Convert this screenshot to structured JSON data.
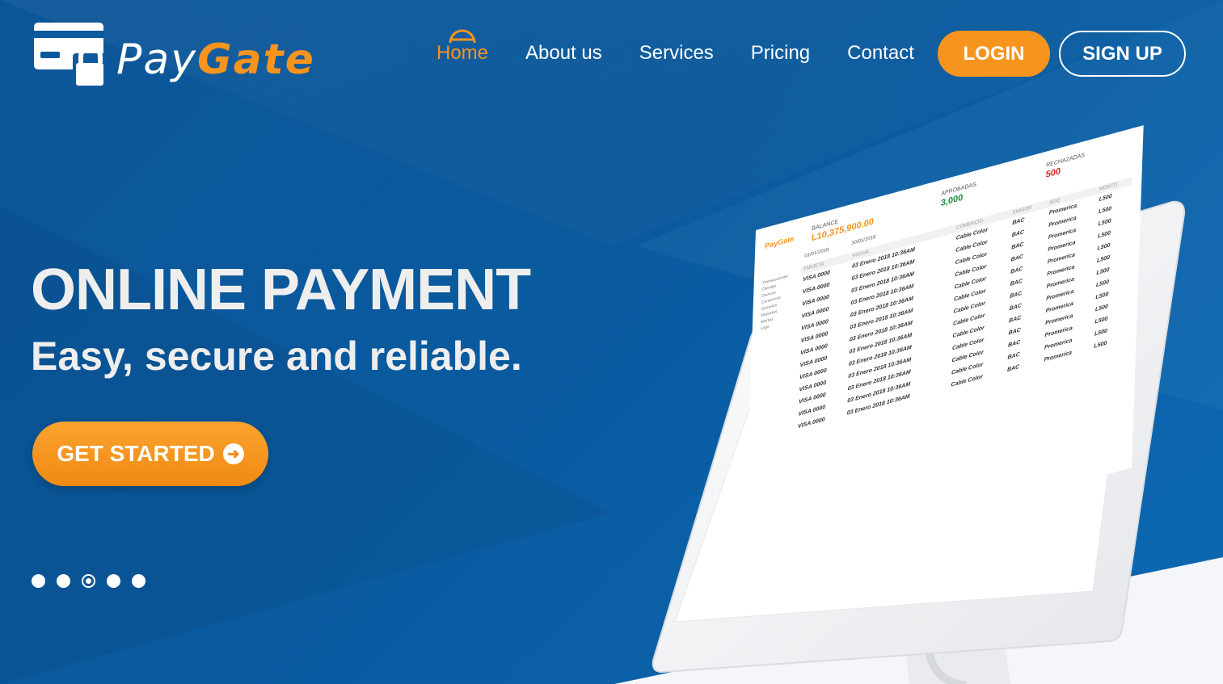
{
  "colors": {
    "accent": "#f7941d",
    "background": "#0b5a9e",
    "text": "#ffffff",
    "approved": "#1e8a3a",
    "rejected": "#e02020"
  },
  "logo": {
    "pay": "Pay",
    "gate": "Gate",
    "icon": "credit-card-lock-icon"
  },
  "nav": {
    "items": [
      {
        "label": "Home",
        "active": true
      },
      {
        "label": "About us",
        "active": false
      },
      {
        "label": "Services",
        "active": false
      },
      {
        "label": "Pricing",
        "active": false
      },
      {
        "label": "Contact",
        "active": false
      }
    ],
    "login": "LOGIN",
    "signup": "SIGN UP"
  },
  "hero": {
    "title": "ONLINE PAYMENT",
    "subtitle": "Easy, secure and reliable.",
    "cta": "GET STARTED",
    "cta_icon": "arrow-circle-right-icon",
    "carousel": {
      "count": 5,
      "active_index": 2
    }
  },
  "dashboard": {
    "logo": "PayGate",
    "stats": [
      {
        "label": "BALANCE",
        "value": "L10,375,900.00"
      },
      {
        "label": "APROBADAS",
        "value": "3,000"
      },
      {
        "label": "RECHAZADAS",
        "value": "500"
      }
    ],
    "dates": [
      "01/01/2018",
      "30/01/2018"
    ],
    "sidebar": [
      "Transacciones",
      "Clientes",
      "Devices",
      "Comercios",
      "Usuarios",
      "Reportes",
      "Alertas",
      "Logs"
    ],
    "columns": [
      "TARJETA",
      "FECHA",
      "COMERCIO",
      "EMISOR",
      "ADQ",
      "MONTO"
    ],
    "rows": [
      [
        "VISA 0000",
        "03 Enero 2018 10:36AM",
        "Cable Color",
        "BAC",
        "Promerica",
        "L500"
      ],
      [
        "VISA 0000",
        "03 Enero 2018 10:36AM",
        "Cable Color",
        "BAC",
        "Promerica",
        "L500"
      ],
      [
        "VISA 0000",
        "03 Enero 2018 10:36AM",
        "Cable Color",
        "BAC",
        "Promerica",
        "L500"
      ],
      [
        "VISA 0000",
        "03 Enero 2018 10:36AM",
        "Cable Color",
        "BAC",
        "Promerica",
        "L500"
      ],
      [
        "VISA 0000",
        "03 Enero 2018 10:36AM",
        "Cable Color",
        "BAC",
        "Promerica",
        "L500"
      ],
      [
        "VISA 0000",
        "03 Enero 2018 10:36AM",
        "Cable Color",
        "BAC",
        "Promerica",
        "L500"
      ],
      [
        "VISA 0000",
        "03 Enero 2018 10:36AM",
        "Cable Color",
        "BAC",
        "Promerica",
        "L500"
      ],
      [
        "VISA 0000",
        "03 Enero 2018 10:36AM",
        "Cable Color",
        "BAC",
        "Promerica",
        "L500"
      ],
      [
        "VISA 0000",
        "03 Enero 2018 10:36AM",
        "Cable Color",
        "BAC",
        "Promerica",
        "L500"
      ],
      [
        "VISA 0000",
        "03 Enero 2018 10:36AM",
        "Cable Color",
        "BAC",
        "Promerica",
        "L500"
      ],
      [
        "VISA 0000",
        "03 Enero 2018 10:36AM",
        "Cable Color",
        "BAC",
        "Promerica",
        "L500"
      ],
      [
        "VISA 0000",
        "03 Enero 2018 10:36AM",
        "Cable Color",
        "BAC",
        "Promerica",
        "L500"
      ],
      [
        "VISA 0000",
        "03 Enero 2018 10:36AM",
        "Cable Color",
        "BAC",
        "Promerica",
        "L500"
      ]
    ]
  }
}
